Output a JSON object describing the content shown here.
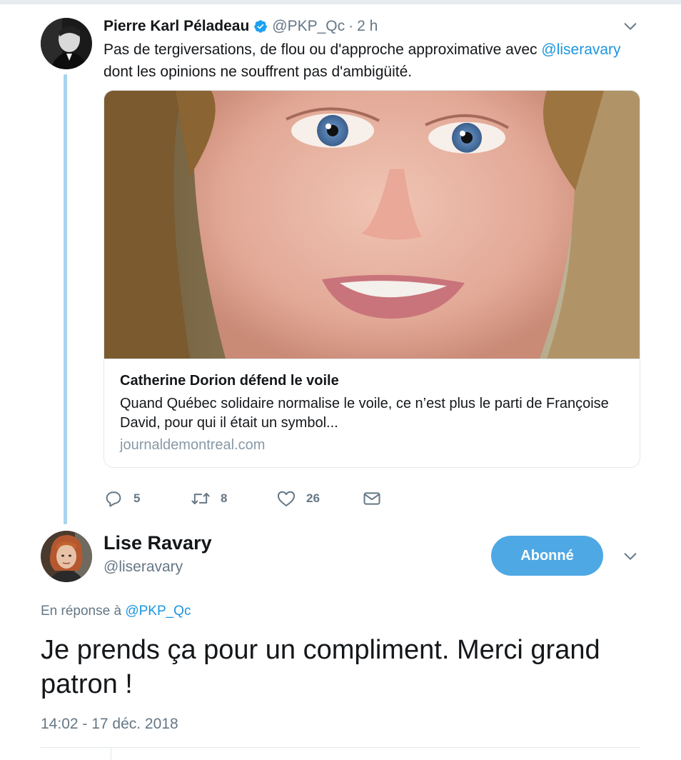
{
  "parent_tweet": {
    "author_name": "Pierre Karl Péladeau",
    "handle": "@PKP_Qc",
    "separator": "·",
    "time_ago": "2 h",
    "text_before_mention": "Pas de tergiversations, de flou ou d'approche approximative avec ",
    "mention": "@liseravary",
    "text_after_mention": " dont les opinions ne souffrent pas d'ambigüité.",
    "card": {
      "title": "Catherine Dorion défend le voile",
      "description": "Quand Québec solidaire normalise le voile, ce n’est plus le parti de Françoise David, pour qui il était un symbol...",
      "domain": "journaldemontreal.com"
    },
    "actions": {
      "reply_count": "5",
      "retweet_count": "8",
      "like_count": "26"
    }
  },
  "reply_tweet": {
    "author_name": "Lise Ravary",
    "handle": "@liseravary",
    "follow_button_label": "Abonné",
    "in_reply_prefix": "En réponse à ",
    "in_reply_mention": "@PKP_Qc",
    "text": "Je prends ça pour un compliment. Merci grand patron !",
    "timestamp": "14:02 - 17 déc. 2018"
  },
  "icons": {
    "verified": "verified-badge-icon",
    "caret": "chevron-down-icon",
    "reply": "reply-icon",
    "retweet": "retweet-icon",
    "like": "heart-icon",
    "dm": "envelope-icon"
  },
  "colors": {
    "link": "#1b95e0",
    "secondary_text": "#657786",
    "follow_button": "#4ea8e4",
    "thread_line": "#a8d4ee"
  }
}
